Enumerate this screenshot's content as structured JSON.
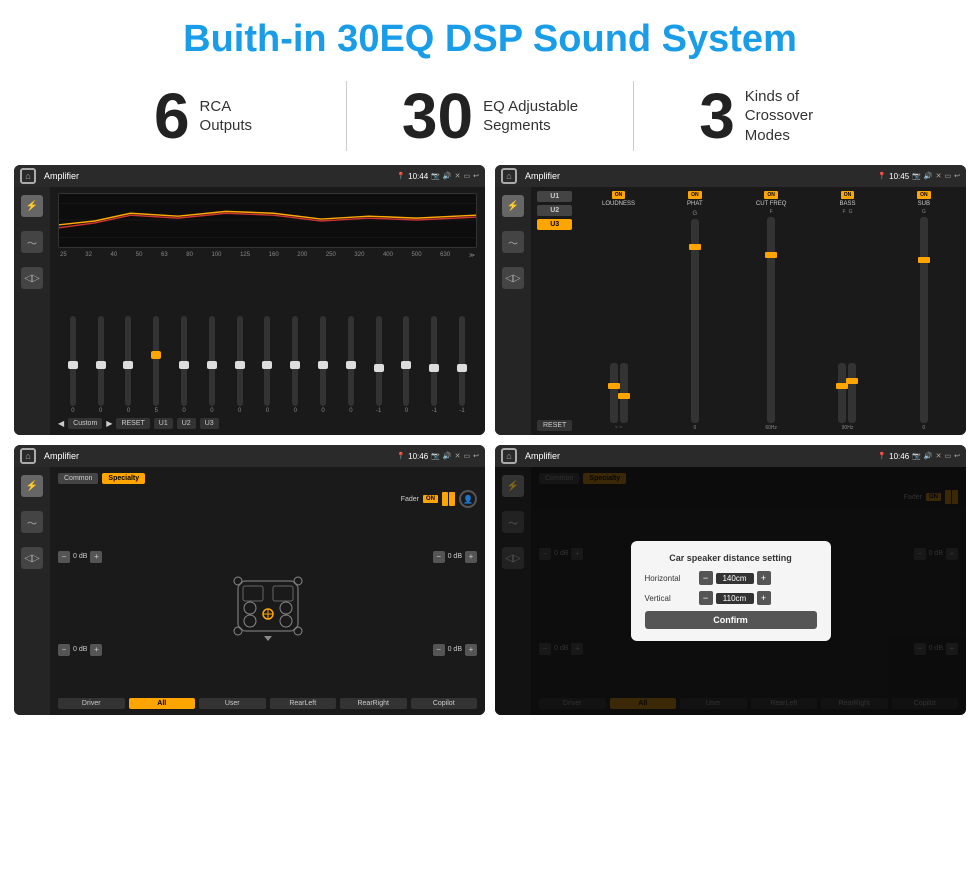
{
  "page": {
    "title": "Buith-in 30EQ DSP Sound System"
  },
  "stats": [
    {
      "number": "6",
      "label": "RCA\nOutputs"
    },
    {
      "number": "30",
      "label": "EQ Adjustable\nSegments"
    },
    {
      "number": "3",
      "label": "Kinds of\nCrossover Modes"
    }
  ],
  "screens": [
    {
      "id": "eq-screen",
      "title": "Amplifier",
      "time": "10:44",
      "type": "eq"
    },
    {
      "id": "amp-screen",
      "title": "Amplifier",
      "time": "10:45",
      "type": "amp"
    },
    {
      "id": "fader-screen",
      "title": "Amplifier",
      "time": "10:46",
      "type": "fader"
    },
    {
      "id": "dialog-screen",
      "title": "Amplifier",
      "time": "10:46",
      "type": "dialog"
    }
  ],
  "eq": {
    "freqs": [
      "25",
      "32",
      "40",
      "50",
      "63",
      "80",
      "100",
      "125",
      "160",
      "200",
      "250",
      "320",
      "400",
      "500",
      "630"
    ],
    "values": [
      "0",
      "0",
      "0",
      "5",
      "0",
      "0",
      "0",
      "0",
      "0",
      "0",
      "0",
      "-1",
      "0",
      "-1"
    ],
    "preset": "Custom",
    "buttons": [
      "RESET",
      "U1",
      "U2",
      "U3"
    ]
  },
  "amp": {
    "presets": [
      "U1",
      "U2",
      "U3"
    ],
    "channels": [
      {
        "name": "LOUDNESS",
        "on": true
      },
      {
        "name": "PHAT",
        "on": true
      },
      {
        "name": "CUT FREQ",
        "on": true
      },
      {
        "name": "BASS",
        "on": true
      },
      {
        "name": "SUB",
        "on": true
      }
    ],
    "reset": "RESET"
  },
  "fader": {
    "tabs": [
      "Common",
      "Specialty"
    ],
    "active_tab": "Specialty",
    "fader_label": "Fader",
    "on": "ON",
    "db_values": [
      "0 dB",
      "0 dB",
      "0 dB",
      "0 dB"
    ],
    "buttons": [
      "Driver",
      "RearLeft",
      "All",
      "User",
      "RearRight",
      "Copilot"
    ]
  },
  "dialog": {
    "title": "Car speaker distance setting",
    "horizontal_label": "Horizontal",
    "horizontal_value": "140cm",
    "vertical_label": "Vertical",
    "vertical_value": "110cm",
    "confirm": "Confirm",
    "db_values": [
      "0 dB",
      "0 dB"
    ],
    "fader_label": "Fader",
    "on": "ON"
  }
}
